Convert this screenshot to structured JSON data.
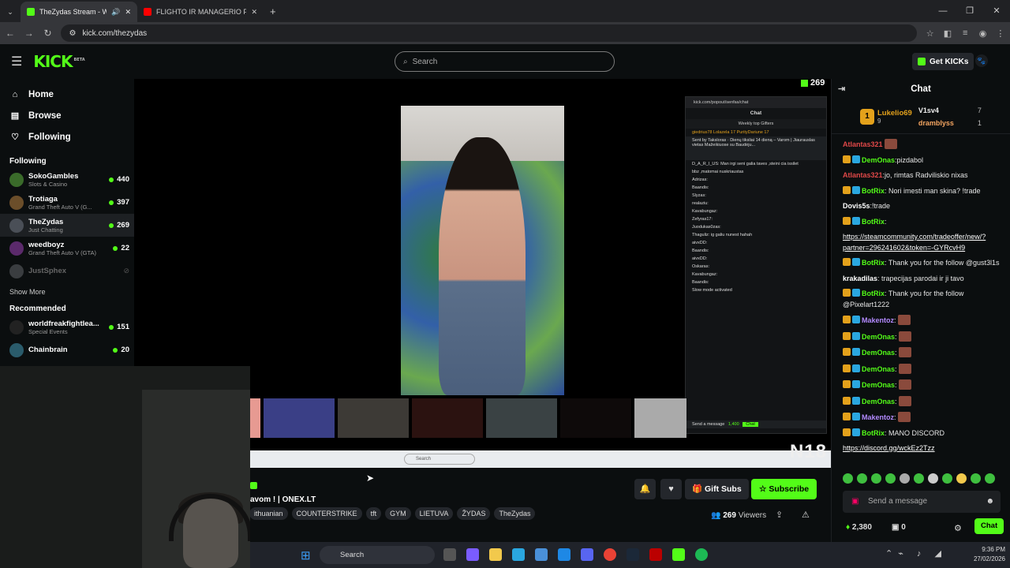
{
  "browser": {
    "tabs": [
      {
        "title": "TheZydas Stream - Watch L",
        "active": true
      },
      {
        "title": "FLIGHTO IR MANAGERIO PIRM",
        "active": false
      }
    ],
    "url": "kick.com/thezydas"
  },
  "header": {
    "logo": "KICK",
    "logo_badge": "BETA",
    "search_placeholder": "Search",
    "get_kicks": "Get KICKs"
  },
  "sidebar": {
    "nav": [
      {
        "label": "Home",
        "icon": "home-icon"
      },
      {
        "label": "Browse",
        "icon": "browse-icon"
      },
      {
        "label": "Following",
        "icon": "heart-icon"
      }
    ],
    "following_heading": "Following",
    "following": [
      {
        "name": "SokoGambles",
        "category": "Slots & Casino",
        "viewers": "440",
        "color": "#3a6b2a"
      },
      {
        "name": "Trotiaga",
        "category": "Grand Theft Auto V (G...",
        "viewers": "397",
        "color": "#6b4e2a"
      },
      {
        "name": "TheZydas",
        "category": "Just Chatting",
        "viewers": "269",
        "color": "#4a4f57"
      },
      {
        "name": "weedboyz",
        "category": "Grand Theft Auto V (GTA)",
        "viewers": "22",
        "color": "#5b2a6b"
      },
      {
        "name": "JustSphex",
        "category": "",
        "viewers": "",
        "color": "#3a3d40"
      }
    ],
    "show_more": "Show More",
    "recommended_heading": "Recommended",
    "recommended": [
      {
        "name": "worldfreakfightlea...",
        "category": "Special Events",
        "viewers": "151",
        "color": "#222"
      },
      {
        "name": "Chainbrain",
        "category": "",
        "viewers": "20",
        "color": "#2a5b6b"
      }
    ]
  },
  "stream": {
    "viewer_badge": "269",
    "popout": {
      "url": "kick.com/popout/senfas/chat",
      "title": "Chat",
      "gifters_title": "Weekly top Gifters",
      "gifters_line": "giedrius78   Lolazela 17   PurityDariune 17",
      "pinned": "Sent by Taksloras · Dienų tiksliai 14 dieną – Varom | Jiaurauslas vietas Mažeikiuose su Baudėju...",
      "lines": [
        "D_A_R_I_US: Man irgi seni galia taves ,steini cia issilet",
        "bbz ,matomai nuskriaustas",
        "Adrizas:",
        "Baandis:",
        "Slyzas:",
        "realaziu:",
        "Kavabungaz:",
        "Zefyras17:",
        "Juodukas0zas:",
        "Thaguliz: ig galiu nunest hahah",
        "aivxDD:",
        "Baandis:",
        "aivxDD:",
        "Oskaras:",
        "Kavabungaz:",
        "Baandis:",
        "Slow mode activated"
      ],
      "send": "Send a message",
      "kicks": "1,400",
      "chat_btn": "Chat"
    },
    "mini_taskbar_search": "Search",
    "rating": "N18"
  },
  "stream_info": {
    "title": "avom ! | ONEX.LT",
    "tags": [
      "ithuanian",
      "COUNTERSTRIKE",
      "tft",
      "GYM",
      "LIETUVA",
      "ŽYDAS",
      "TheZydas"
    ],
    "gift_subs": "Gift Subs",
    "subscribe": "Subscribe",
    "viewers_count": "269",
    "viewers_label": "Viewers"
  },
  "chat": {
    "title": "Chat",
    "top_gifter": {
      "name": "Lukelio69",
      "count": "9"
    },
    "gifter2": {
      "name": "V1sv4",
      "count": "7"
    },
    "gifter3": {
      "name": "dramblyss",
      "count": "1"
    },
    "messages": [
      {
        "user": "Atlantas321",
        "color": "#e04848",
        "text": ""
      },
      {
        "user": "DemOnas",
        "color": "#53fc18",
        "text": ":pizdabol"
      },
      {
        "user": "Atlantas321",
        "color": "#e04848",
        "text": ":jo, rimtas Radviliskio nixas"
      },
      {
        "user": "BotRix",
        "color": "#53fc18",
        "text": ": Nori imesti man skina? !trade"
      },
      {
        "user": "Dovis5s",
        "color": "#ffffff",
        "text": ":!trade"
      },
      {
        "user": "BotRix",
        "color": "#53fc18",
        "text": ":"
      },
      {
        "user": "",
        "color": "#ffffff",
        "text": "https://steamcommunity.com/tradeoffer/new/?partner=296241602&token=-GYRcvH9"
      },
      {
        "user": "BotRix",
        "color": "#53fc18",
        "text": ": Thank you for the follow @gust3l1s"
      },
      {
        "user": "krakadilas",
        "color": "#ffffff",
        "text": ": trapecijas parodai ir ji tavo"
      },
      {
        "user": "BotRix",
        "color": "#53fc18",
        "text": ": Thank you for the follow @Pixelart1222"
      },
      {
        "user": "Makentoz",
        "color": "#b38aff",
        "text": ":"
      },
      {
        "user": "DemOnas",
        "color": "#53fc18",
        "text": ":"
      },
      {
        "user": "DemOnas",
        "color": "#53fc18",
        "text": ":"
      },
      {
        "user": "DemOnas",
        "color": "#53fc18",
        "text": ":"
      },
      {
        "user": "DemOnas",
        "color": "#53fc18",
        "text": ":"
      },
      {
        "user": "DemOnas",
        "color": "#53fc18",
        "text": ":"
      },
      {
        "user": "Makentoz",
        "color": "#b38aff",
        "text": ":"
      },
      {
        "user": "BotRix",
        "color": "#53fc18",
        "text": ": MANO DISCORD"
      },
      {
        "user": "",
        "color": "#ffffff",
        "text": "https://discord.gg/wckEz2Tzz"
      }
    ],
    "send_placeholder": "Send a message",
    "kicks": "2,380",
    "zero": "0",
    "chat_btn": "Chat"
  },
  "taskbar": {
    "search": "Search",
    "time": "9:36 PM",
    "date": "27/02/2026"
  }
}
